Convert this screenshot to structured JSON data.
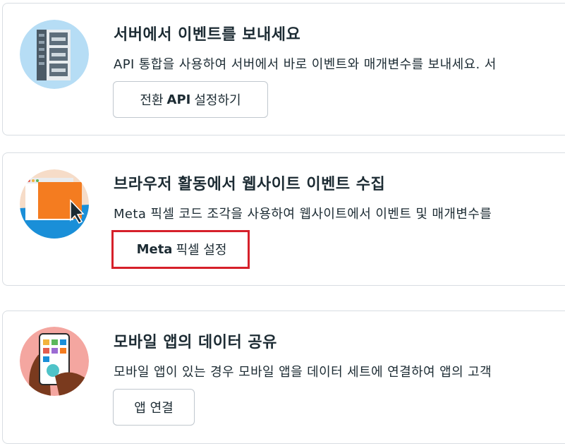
{
  "cards": [
    {
      "title": "서버에서 이벤트를 보내세요",
      "description": "API 통합을 사용하여 서버에서 바로 이벤트와 매개변수를 보내세요. 서",
      "button": {
        "prefix": "전환",
        "bold": "API",
        "suffix": "설정하기"
      },
      "illustration": "server-rack-icon"
    },
    {
      "title": "브라우저 활동에서 웹사이트 이벤트 수집",
      "description": "Meta 픽셀 코드 조각을 사용하여 웹사이트에서 이벤트 및 매개변수를",
      "button": {
        "prefix": "",
        "bold": "Meta",
        "suffix": "픽셀 설정"
      },
      "illustration": "browser-cursor-icon"
    },
    {
      "title": "모바일 앱의 데이터 공유",
      "description": "모바일 앱이 있는 경우 모바일 앱을 데이터 세트에 연결하여 앱의 고객",
      "button": {
        "prefix": "",
        "bold": "",
        "suffix": "앱 연결"
      },
      "illustration": "mobile-app-hand-icon"
    }
  ],
  "colors": {
    "highlight": "#d6202a",
    "border": "#d8dde2",
    "text": "#1c2b33"
  }
}
